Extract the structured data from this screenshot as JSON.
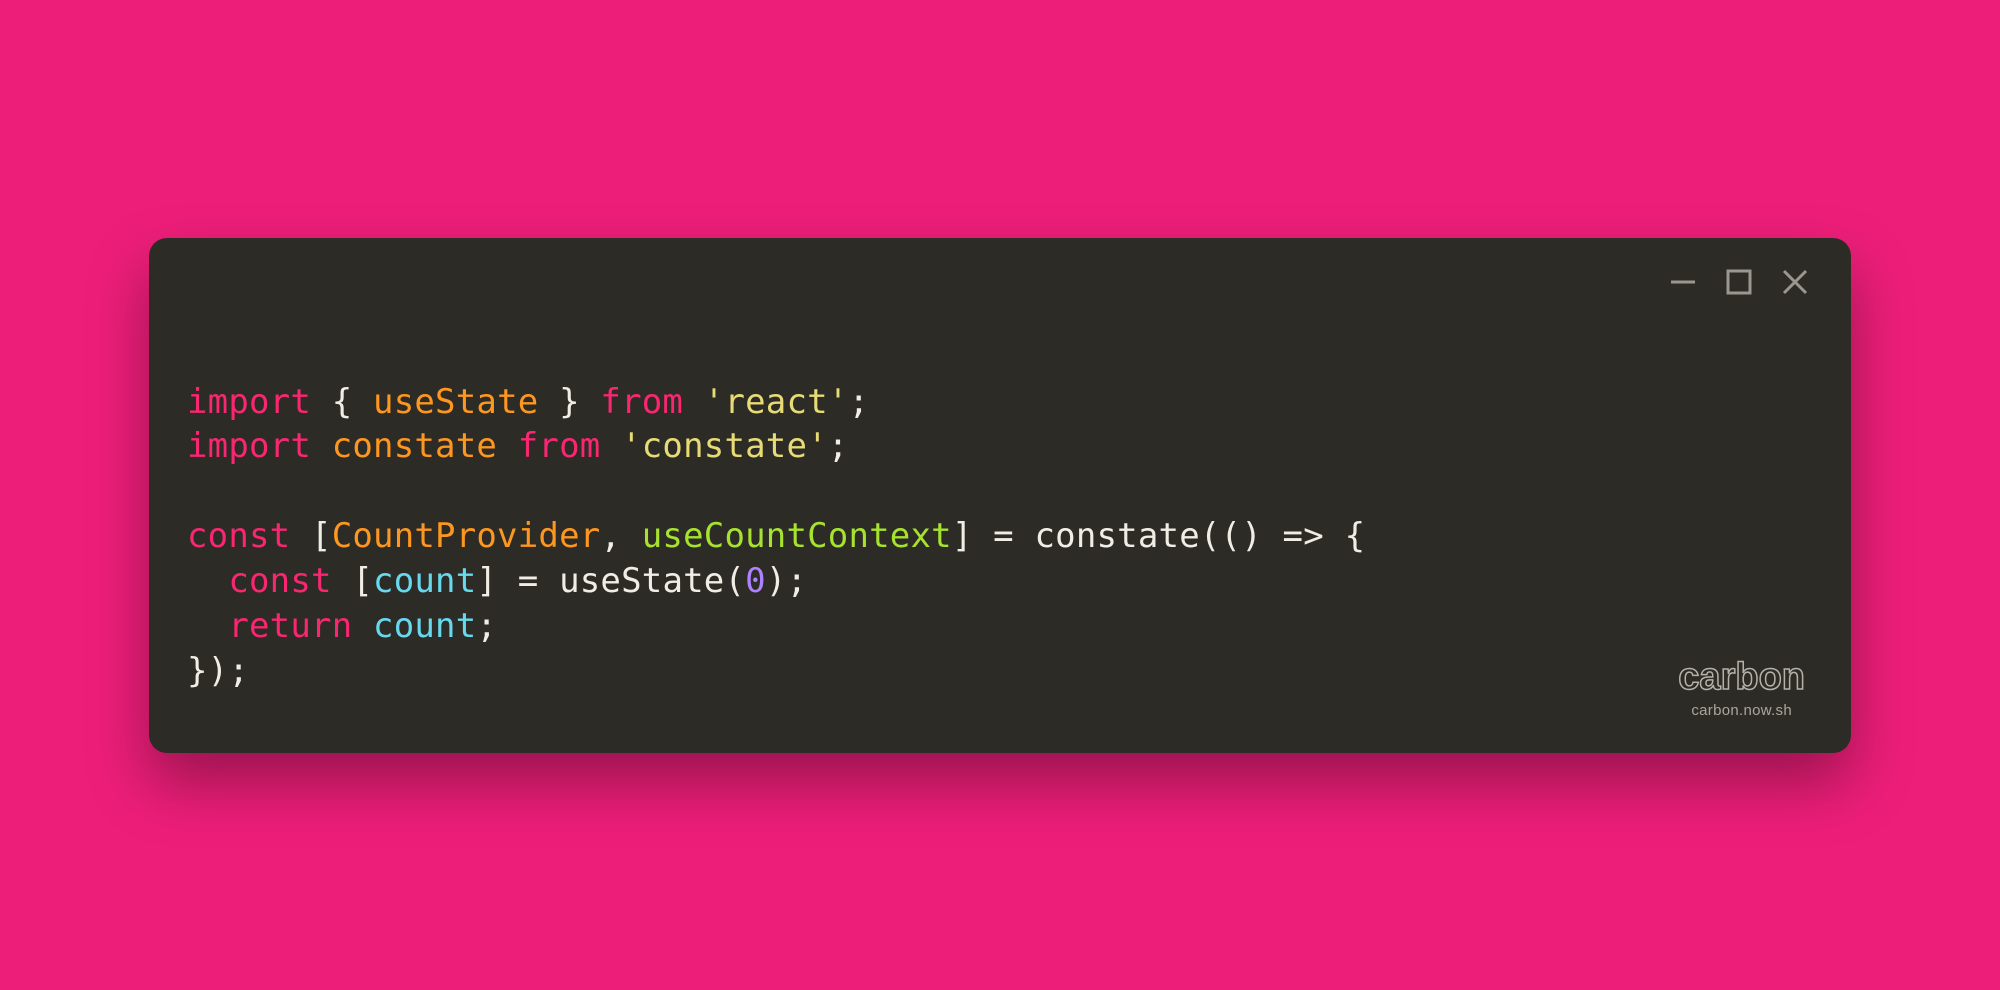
{
  "colors": {
    "bg": "#ed1e79",
    "window_bg": "#2d2b26",
    "text": "#f0ede4",
    "keyword": "#f92672",
    "class": "#fd971f",
    "func": "#a6e22e",
    "string": "#e6db74",
    "number": "#ae81ff",
    "var": "#66d9ef"
  },
  "code": {
    "lines": [
      [
        {
          "t": "import",
          "c": "keyword"
        },
        {
          "t": " ",
          "c": "punct"
        },
        {
          "t": "{",
          "c": "punct"
        },
        {
          "t": " ",
          "c": "punct"
        },
        {
          "t": "useState",
          "c": "class"
        },
        {
          "t": " ",
          "c": "punct"
        },
        {
          "t": "}",
          "c": "punct"
        },
        {
          "t": " ",
          "c": "punct"
        },
        {
          "t": "from",
          "c": "keyword"
        },
        {
          "t": " ",
          "c": "punct"
        },
        {
          "t": "'react'",
          "c": "string"
        },
        {
          "t": ";",
          "c": "punct"
        }
      ],
      [
        {
          "t": "import",
          "c": "keyword"
        },
        {
          "t": " ",
          "c": "punct"
        },
        {
          "t": "constate",
          "c": "class"
        },
        {
          "t": " ",
          "c": "punct"
        },
        {
          "t": "from",
          "c": "keyword"
        },
        {
          "t": " ",
          "c": "punct"
        },
        {
          "t": "'constate'",
          "c": "string"
        },
        {
          "t": ";",
          "c": "punct"
        }
      ],
      [],
      [
        {
          "t": "const",
          "c": "keyword"
        },
        {
          "t": " ",
          "c": "punct"
        },
        {
          "t": "[",
          "c": "punct"
        },
        {
          "t": "CountProvider",
          "c": "class"
        },
        {
          "t": ",",
          "c": "punct"
        },
        {
          "t": " ",
          "c": "punct"
        },
        {
          "t": "useCountContext",
          "c": "func"
        },
        {
          "t": "]",
          "c": "punct"
        },
        {
          "t": " ",
          "c": "punct"
        },
        {
          "t": "=",
          "c": "punct"
        },
        {
          "t": " ",
          "c": "punct"
        },
        {
          "t": "constate",
          "c": "ident"
        },
        {
          "t": "(()",
          "c": "punct"
        },
        {
          "t": " ",
          "c": "punct"
        },
        {
          "t": "=>",
          "c": "punct"
        },
        {
          "t": " ",
          "c": "punct"
        },
        {
          "t": "{",
          "c": "punct"
        }
      ],
      [
        {
          "t": "  ",
          "c": "punct"
        },
        {
          "t": "const",
          "c": "keyword"
        },
        {
          "t": " ",
          "c": "punct"
        },
        {
          "t": "[",
          "c": "punct"
        },
        {
          "t": "count",
          "c": "var"
        },
        {
          "t": "]",
          "c": "punct"
        },
        {
          "t": " ",
          "c": "punct"
        },
        {
          "t": "=",
          "c": "punct"
        },
        {
          "t": " ",
          "c": "punct"
        },
        {
          "t": "useState",
          "c": "ident"
        },
        {
          "t": "(",
          "c": "punct"
        },
        {
          "t": "0",
          "c": "number"
        },
        {
          "t": ")",
          "c": "punct"
        },
        {
          "t": ";",
          "c": "punct"
        }
      ],
      [
        {
          "t": "  ",
          "c": "punct"
        },
        {
          "t": "return",
          "c": "keyword"
        },
        {
          "t": " ",
          "c": "punct"
        },
        {
          "t": "count",
          "c": "var"
        },
        {
          "t": ";",
          "c": "punct"
        }
      ],
      [
        {
          "t": "});",
          "c": "punct"
        }
      ]
    ]
  },
  "branding": {
    "logo": "carbon",
    "sub": "carbon.now.sh"
  }
}
